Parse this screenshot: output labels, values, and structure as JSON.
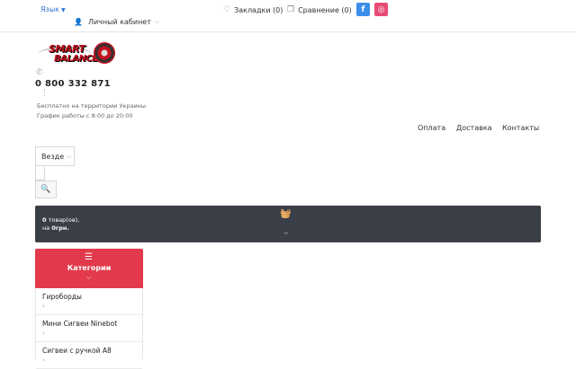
{
  "topbar": {
    "language": "Язык",
    "bookmarks": "Закладки (0)",
    "compare": "Сравнение (0)",
    "facebook_icon": "f",
    "instagram_icon": "◎",
    "account": "Личный кабинет"
  },
  "header": {
    "logo_line1": "SMART",
    "logo_line2": "BALANCE",
    "phone": "0 800 332 871",
    "free_note": "Бесплатно на территории Украины",
    "hours": "График работы с 8:00 до 20:00"
  },
  "nav": {
    "payment": "Оплата",
    "delivery": "Доставка",
    "contacts": "Контакты"
  },
  "search": {
    "scope": "Везде",
    "placeholder": ""
  },
  "cart": {
    "count": "0",
    "count_suffix": " товар(ов),",
    "total_prefix": "на ",
    "total": "0грн."
  },
  "categories": {
    "title": "Категории",
    "items": [
      {
        "label": "Гироборды"
      },
      {
        "label": "Мини Сигвеи Ninebot"
      },
      {
        "label": "Сигвеи с ручкой A8"
      }
    ]
  },
  "colors": {
    "accent": "#e23a4c",
    "cart_bg": "#3a3f47",
    "link": "#2f6fd6",
    "facebook": "#3b8de8",
    "instagram": "#e84c74"
  }
}
